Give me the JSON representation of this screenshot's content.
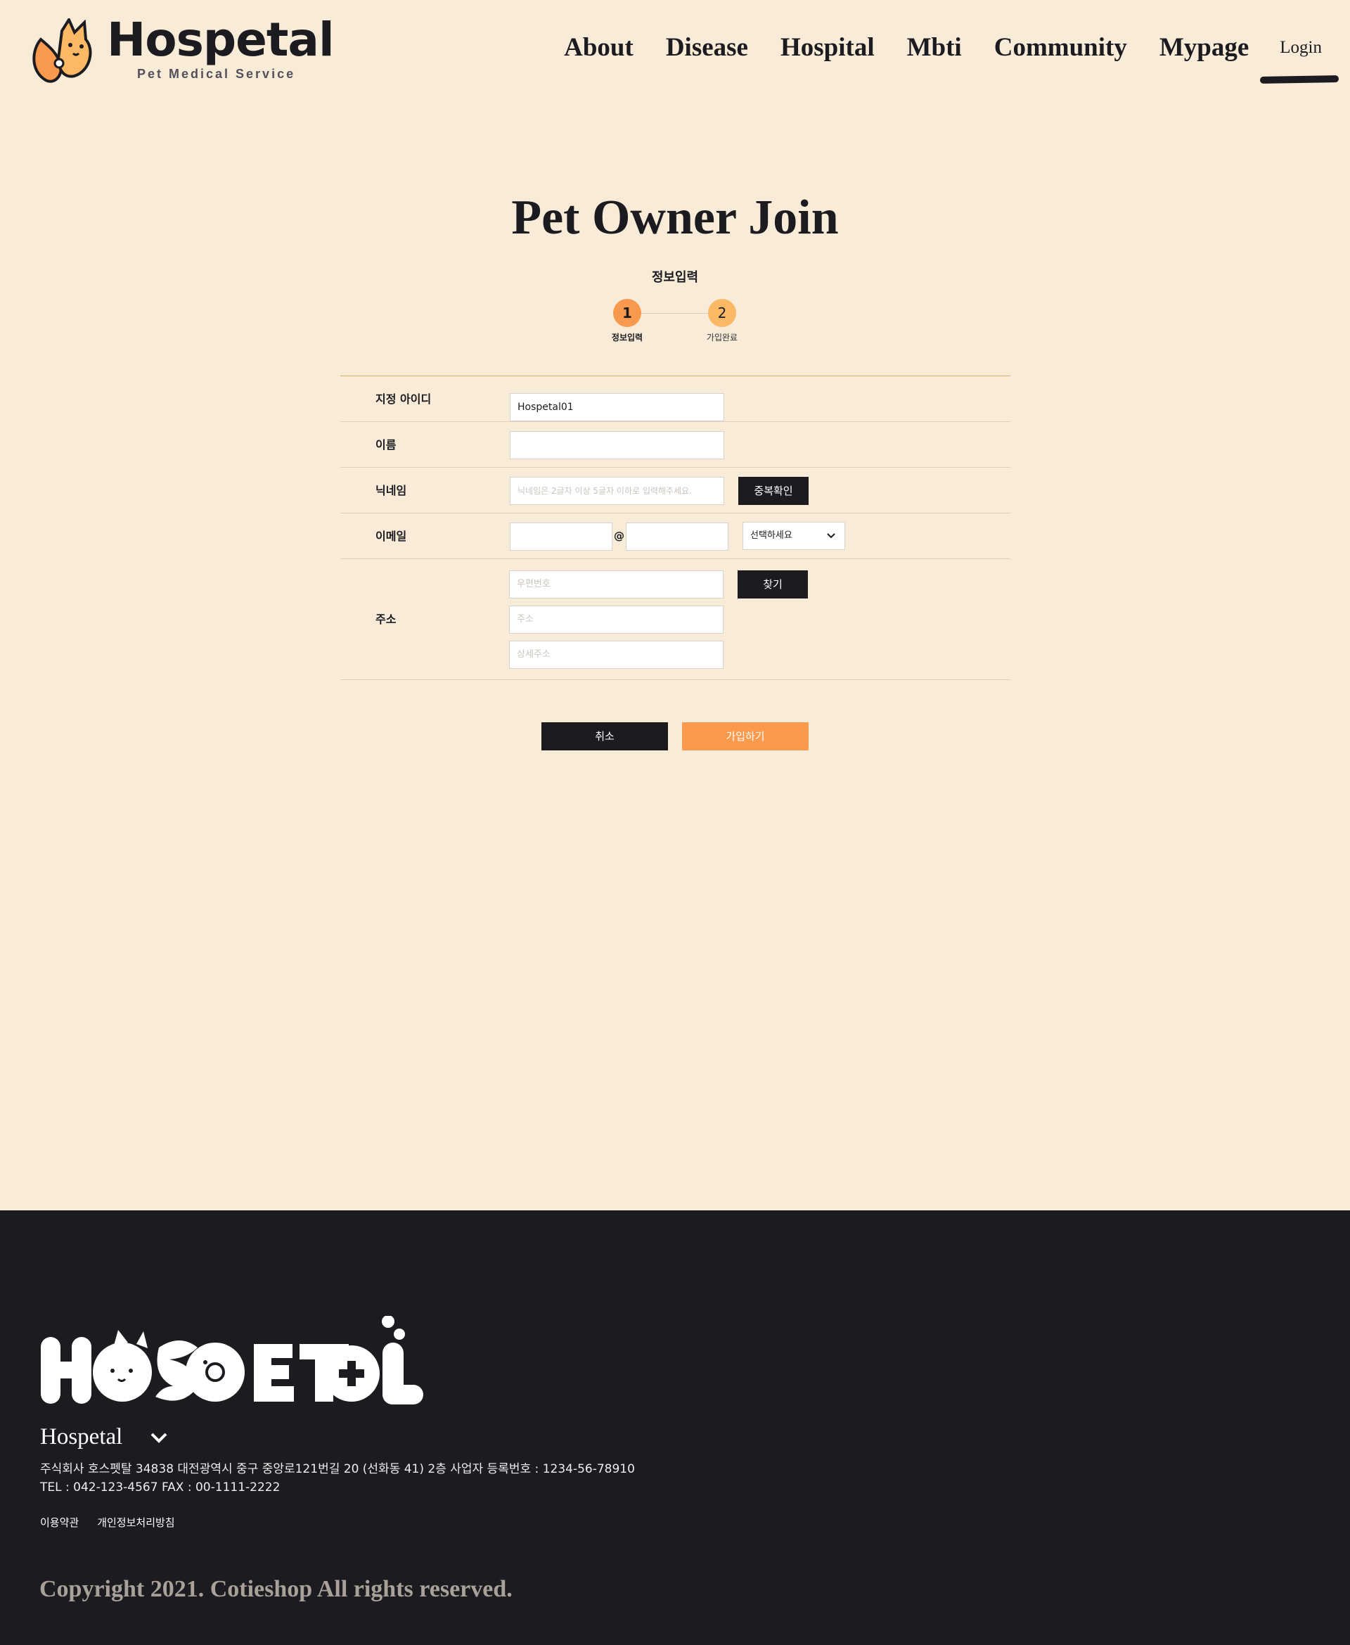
{
  "header": {
    "logo_word": "Hospetal",
    "logo_sub": "Pet Medical Service",
    "nav": [
      "About",
      "Disease",
      "Hospital",
      "Mbti",
      "Community",
      "Mypage"
    ],
    "login": "Login"
  },
  "main": {
    "title": "Pet Owner Join",
    "step_title": "정보입력",
    "steps": [
      {
        "num": "1",
        "label": "정보입력"
      },
      {
        "num": "2",
        "label": "가입완료"
      }
    ]
  },
  "form": {
    "id_label": "지정 아이디",
    "id_value": "Hospetal01",
    "name_label": "이름",
    "name_value": "",
    "nickname_label": "닉네임",
    "nickname_placeholder": "닉네임은 2글자 이상 5글자 이하로 입력해주세요.",
    "dup_check": "중복확인",
    "email_label": "이메일",
    "email_at": "@",
    "email_select": "선택하세요",
    "address_label": "주소",
    "zip_placeholder": "우편번호",
    "find": "찾기",
    "addr_placeholder": "주소",
    "detail_placeholder": "상세주소",
    "cancel": "취소",
    "submit": "가입하기"
  },
  "footer": {
    "name": "Hospetal",
    "info_line1": "주식회사 호스펫탈 34838 대전광역시 중구 중앙로121번길 20 (선화동 41) 2층  사업자 등록번호 : 1234-56-78910",
    "info_line2": "TEL : 042-123-4567 FAX : 00-1111-2222",
    "links": [
      "이용약관",
      "개인정보처리방침"
    ],
    "copyright": "Copyright 2021. Cotieshop All rights reserved."
  },
  "colors": {
    "background": "#f8ebd8",
    "dark": "#1c1b20",
    "accent": "#fb9a4d"
  }
}
